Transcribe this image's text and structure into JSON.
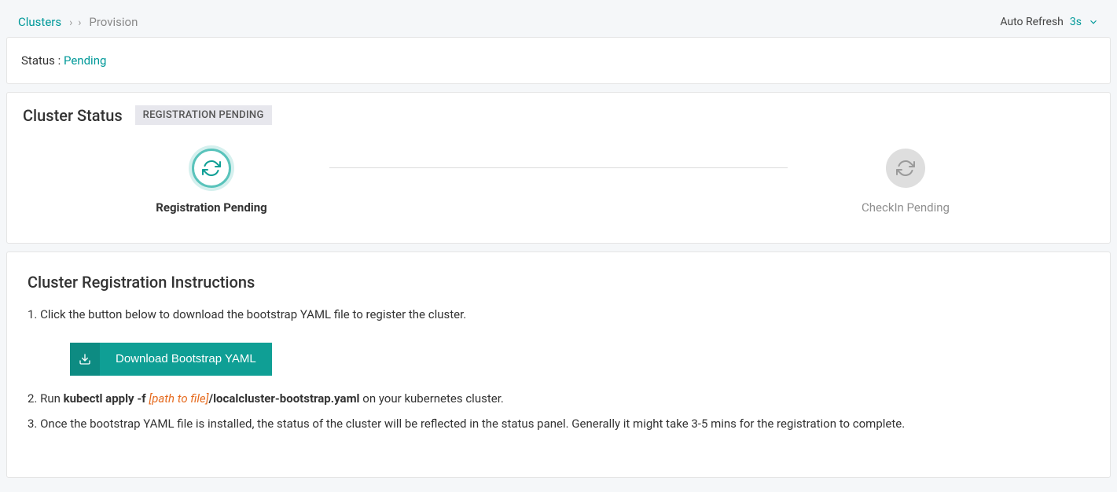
{
  "breadcrumb": {
    "root": "Clusters",
    "current": "Provision"
  },
  "autorefresh": {
    "label": "Auto Refresh",
    "interval": "3s"
  },
  "status": {
    "label": "Status :",
    "value": "Pending"
  },
  "cluster_status": {
    "heading": "Cluster Status",
    "badge": "REGISTRATION PENDING",
    "steps": [
      {
        "label": "Registration Pending"
      },
      {
        "label": "CheckIn Pending"
      }
    ]
  },
  "instructions": {
    "heading": "Cluster Registration Instructions",
    "line1": "1. Click the button below to download the bootstrap YAML file to register the cluster.",
    "download_button": "Download Bootstrap YAML",
    "line2_prefix": "2. Run ",
    "line2_cmd": "kubectl apply -f ",
    "line2_path": "[path to file]",
    "line2_cmd_tail": "/localcluster-bootstrap.yaml",
    "line2_suffix": " on your kubernetes cluster.",
    "line3": "3. Once the bootstrap YAML file is installed, the status of the cluster will be reflected in the status panel. Generally it might take 3-5 mins for the registration to complete."
  }
}
